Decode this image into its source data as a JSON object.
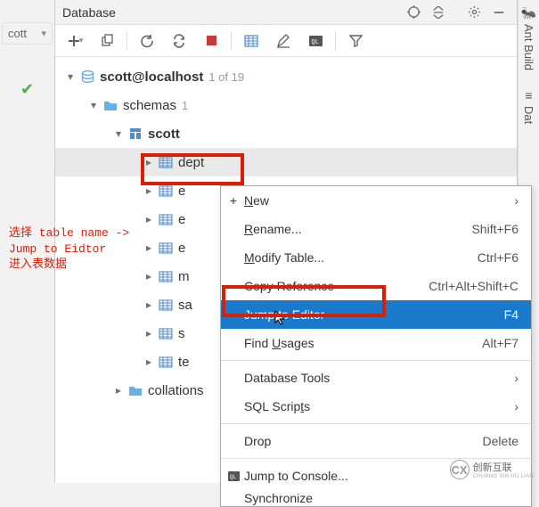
{
  "left_dropdown_label": "cott",
  "panel_title": "Database",
  "connection": {
    "label": "scott@localhost",
    "count": "1 of 19"
  },
  "schemas": {
    "label": "schemas",
    "count": "1"
  },
  "scott_schema": {
    "label": "scott"
  },
  "tables": {
    "dept": "dept",
    "e1": "e",
    "e2": "e",
    "ex": "e",
    "m": "m",
    "sa": "sa",
    "st": "s",
    "te": "te"
  },
  "collations": "collations",
  "menu": {
    "new": "New",
    "rename": "Rename...",
    "modify": "Modify Table...",
    "copyref": "Copy Reference",
    "jump": "Jump to Editor",
    "find": "Find Usages",
    "dbtools": "Database Tools",
    "sqlscripts": "SQL Scripts",
    "drop": "Drop",
    "jumpconsole": "Jump to Console...",
    "sync": "Synchronize",
    "sc_rename": "Shift+F6",
    "sc_modify": "Ctrl+F6",
    "sc_copyref": "Ctrl+Alt+Shift+C",
    "sc_jump": "F4",
    "sc_find": "Alt+F7",
    "sc_drop": "Delete"
  },
  "annotation_l1": "选择 table name ->",
  "annotation_l2": "Jump to Eidtor",
  "annotation_l3": "进入表数据",
  "rail": {
    "ant": "Ant Build",
    "db": "Dat"
  },
  "watermark_brand": "创新互联",
  "watermark_sub": "CHUANG XIN HU LIAN"
}
